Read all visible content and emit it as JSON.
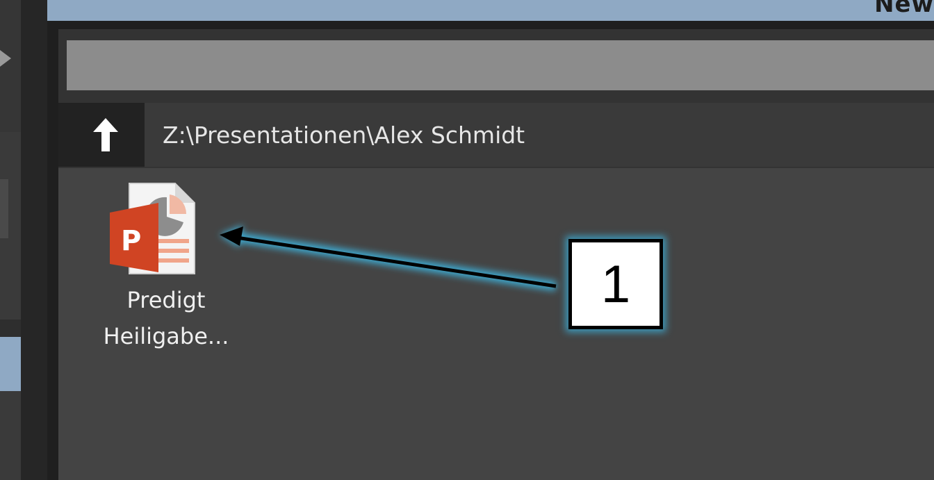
{
  "window": {
    "title_fragment": "New"
  },
  "navigation": {
    "up_icon": "arrow-up-icon",
    "path": "Z:\\Presentationen\\Alex Schmidt"
  },
  "files": [
    {
      "icon": "powerpoint-file-icon",
      "name_line1": "Predigt",
      "name_line2": "Heiligabe..."
    }
  ],
  "annotation": {
    "number": "1"
  },
  "colors": {
    "title_bar": "#8fa9c4",
    "files_bg": "#444444",
    "callout_glow": "#3caad2",
    "ppt_orange": "#d04423"
  }
}
